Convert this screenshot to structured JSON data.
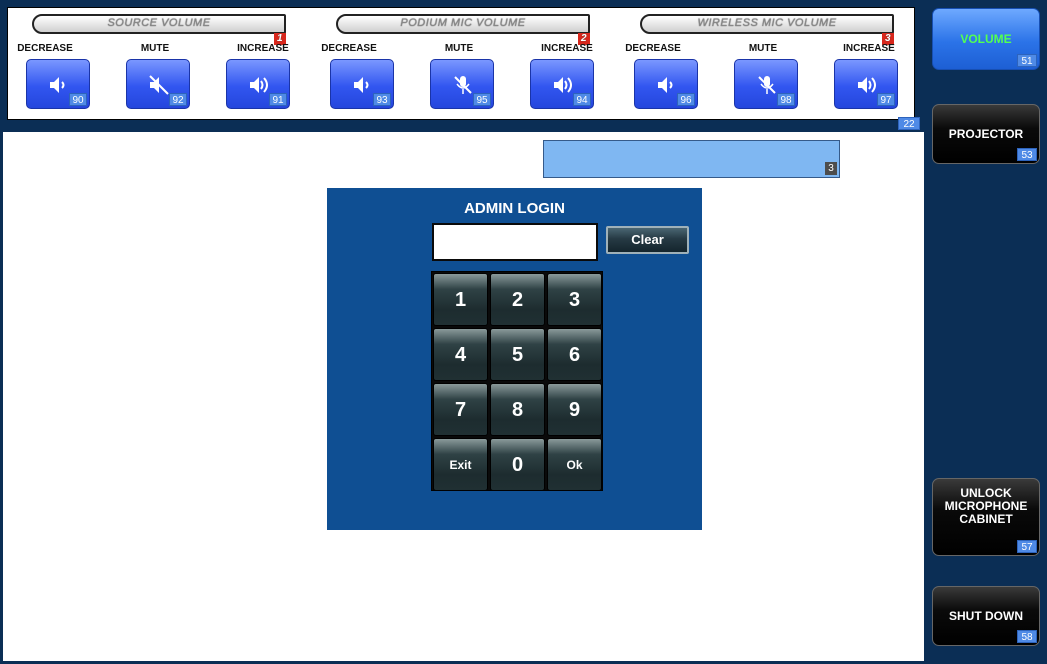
{
  "volume_groups": [
    {
      "title": "SOURCE VOLUME",
      "title_num": "1",
      "decrease": {
        "label": "DECREASE",
        "num": "90"
      },
      "mute": {
        "label": "MUTE",
        "num": "92"
      },
      "increase": {
        "label": "INCREASE",
        "num": "91"
      }
    },
    {
      "title": "PODIUM MIC VOLUME",
      "title_num": "2",
      "decrease": {
        "label": "DECREASE",
        "num": "93"
      },
      "mute": {
        "label": "MUTE",
        "num": "95"
      },
      "increase": {
        "label": "INCREASE",
        "num": "94"
      }
    },
    {
      "title": "WIRELESS MIC VOLUME",
      "title_num": "3",
      "decrease": {
        "label": "DECREASE",
        "num": "96"
      },
      "mute": {
        "label": "MUTE",
        "num": "98"
      },
      "increase": {
        "label": "INCREASE",
        "num": "97"
      }
    }
  ],
  "topbar_num": "22",
  "sidebar": {
    "volume": {
      "label": "VOLUME",
      "num": "51"
    },
    "projector": {
      "label": "PROJECTOR",
      "num": "53"
    },
    "unlock": {
      "label_line1": "UNLOCK",
      "label_line2": "MICROPHONE",
      "label_line3": "CABINET",
      "num": "57"
    },
    "shutdown": {
      "label": "SHUT DOWN",
      "num": "58"
    }
  },
  "status_field": {
    "value": "",
    "num": "3"
  },
  "login": {
    "title": "ADMIN LOGIN",
    "pin_value": "",
    "clear_label": "Clear",
    "keys": [
      "1",
      "2",
      "3",
      "4",
      "5",
      "6",
      "7",
      "8",
      "9",
      "Exit",
      "0",
      "Ok"
    ]
  },
  "colors": {
    "frame": "#0b2e55",
    "login_panel": "#0f4f93",
    "volume_button": "#3256f0",
    "active_text": "#53ff53",
    "status_field": "#7fb7f2"
  },
  "icons": {
    "decrease": "speaker-low-icon",
    "mute_source": "speaker-muted-icon",
    "mute_mic": "microphone-muted-icon",
    "increase": "speaker-high-icon"
  }
}
